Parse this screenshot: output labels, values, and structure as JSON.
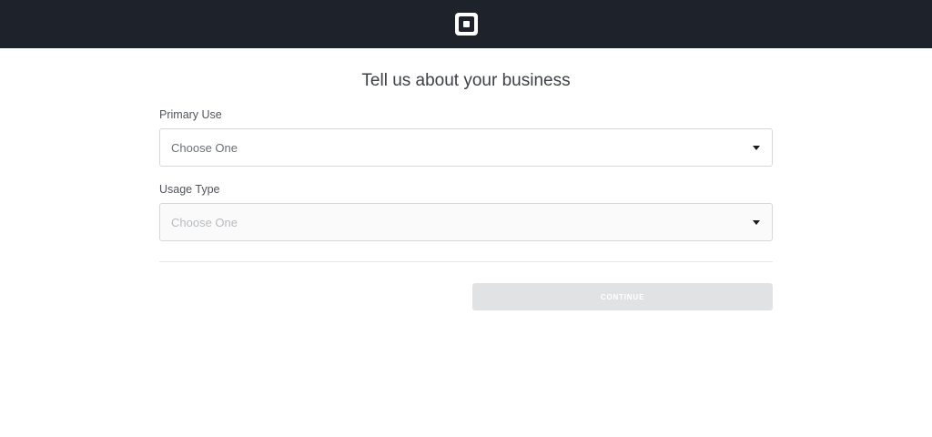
{
  "header": {
    "logo_icon": "square-logo-icon",
    "background_color": "#1e222b"
  },
  "page": {
    "title": "Tell us about your business"
  },
  "form": {
    "primary_use": {
      "label": "Primary Use",
      "value": "Choose One",
      "icon": "caret-down-icon",
      "disabled": false
    },
    "usage_type": {
      "label": "Usage Type",
      "value": "Choose One",
      "icon": "caret-down-icon",
      "disabled": true
    },
    "continue_label": "CONTINUE",
    "continue_color": "#e1e2e3"
  }
}
